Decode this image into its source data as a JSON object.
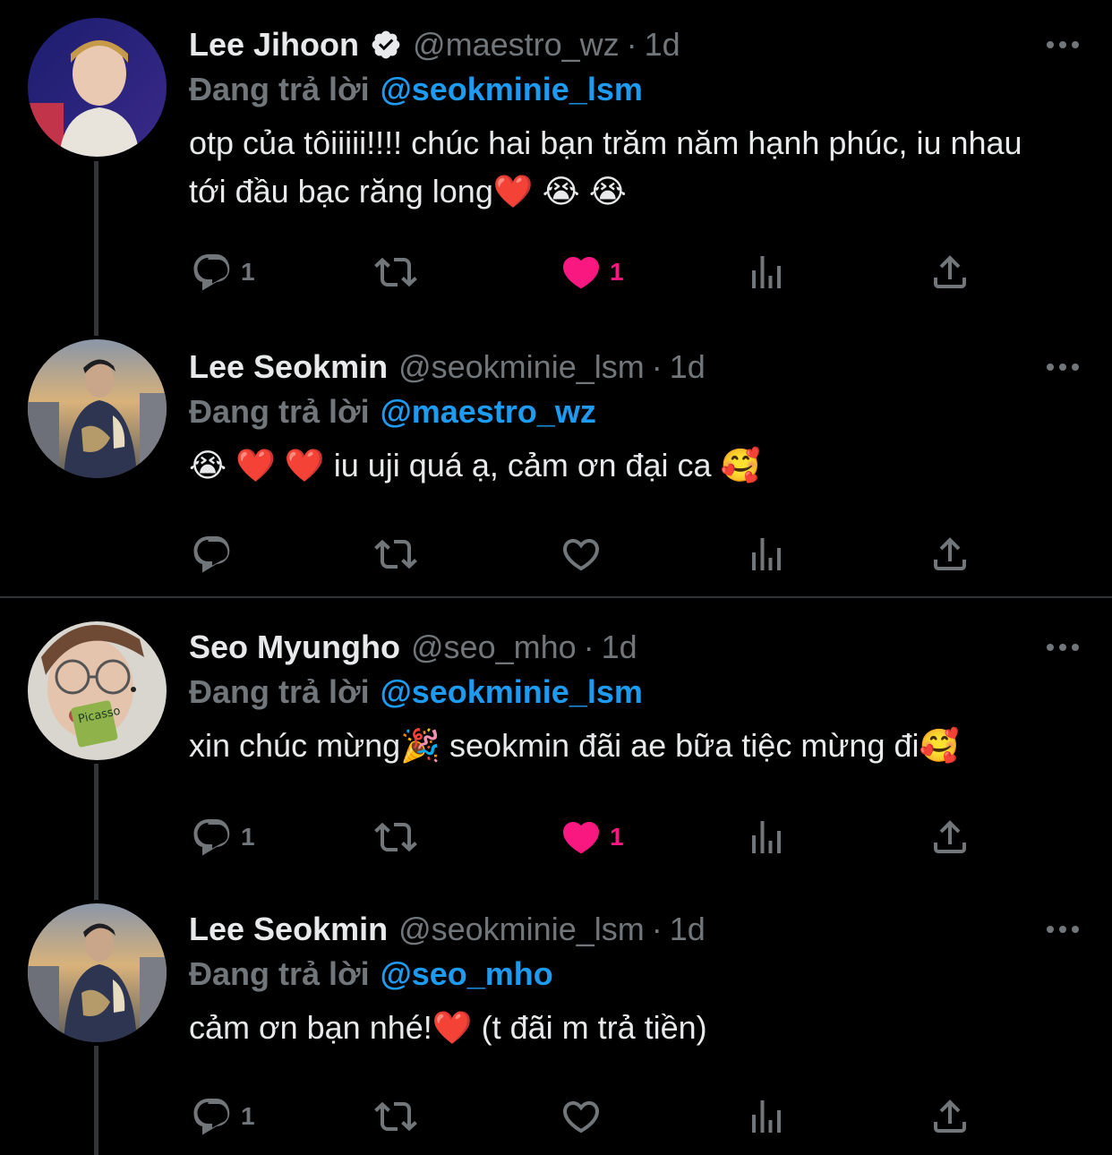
{
  "reply_prefix": "Đang trả lời",
  "colors": {
    "background": "#000000",
    "text": "#e7e9ea",
    "muted": "#71767b",
    "link": "#1d9bf0",
    "like": "#f91880",
    "thread_line": "#333639"
  },
  "tweets": [
    {
      "display_name": "Lee Jihoon",
      "verified": true,
      "handle": "@maestro_wz",
      "time": "1d",
      "reply_to": "@seokminie_lsm",
      "text": "otp của tôiiiii!!!! chúc hai bạn trăm năm hạnh phúc, iu nhau tới đầu bạc răng long❤️ 😭 😭",
      "reply_count": "1",
      "retweet_count": "",
      "like_count": "1",
      "liked": true
    },
    {
      "display_name": "Lee Seokmin",
      "verified": false,
      "handle": "@seokminie_lsm",
      "time": "1d",
      "reply_to": "@maestro_wz",
      "text": "😭 ❤️ ❤️ iu uji quá ạ, cảm ơn đại ca 🥰",
      "reply_count": "",
      "retweet_count": "",
      "like_count": "",
      "liked": false
    },
    {
      "display_name": "Seo Myungho",
      "verified": false,
      "handle": "@seo_mho",
      "time": "1d",
      "reply_to": "@seokminie_lsm",
      "text": "xin chúc mừng🎉 seokmin đãi ae bữa tiệc mừng đi🥰",
      "reply_count": "1",
      "retweet_count": "",
      "like_count": "1",
      "liked": true
    },
    {
      "display_name": "Lee Seokmin",
      "verified": false,
      "handle": "@seokminie_lsm",
      "time": "1d",
      "reply_to": "@seo_mho",
      "text": "cảm ơn bạn nhé!❤️ (t đãi m trả tiền)",
      "reply_count": "1",
      "retweet_count": "",
      "like_count": "",
      "liked": false
    }
  ],
  "icons": {
    "reply": "reply-icon",
    "retweet": "retweet-icon",
    "like": "heart-icon",
    "views": "analytics-icon",
    "share": "share-icon",
    "more": "more-icon",
    "verified": "verified-badge-icon"
  }
}
